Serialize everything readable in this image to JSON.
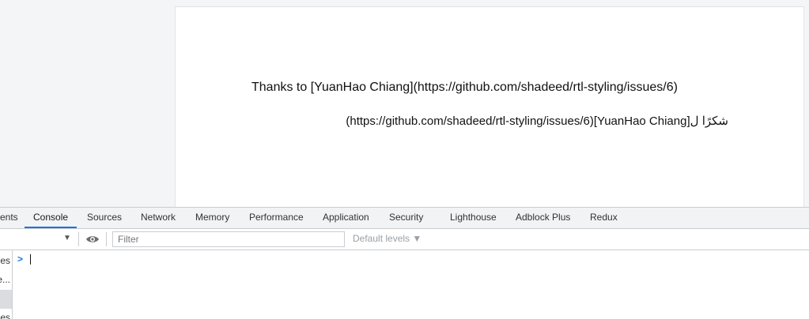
{
  "page": {
    "ltr_text": "Thanks to [YuanHao Chiang](https://github.com/shadeed/rtl-styling/issues/6)",
    "rtl_text": "شكرًا ل[YuanHao Chiang](https://github.com/shadeed/rtl-styling/issues/6)"
  },
  "devtools": {
    "tabs": [
      {
        "label": "ents"
      },
      {
        "label": "Console"
      },
      {
        "label": "Sources"
      },
      {
        "label": "Network"
      },
      {
        "label": "Memory"
      },
      {
        "label": "Performance"
      },
      {
        "label": "Application"
      },
      {
        "label": "Security"
      },
      {
        "label": "Lighthouse"
      },
      {
        "label": "Adblock Plus"
      },
      {
        "label": "Redux"
      }
    ],
    "active_tab": "Console",
    "toolbar": {
      "filter_placeholder": "Filter",
      "levels_label": "Default levels ▼"
    },
    "sidebar_items": [
      {
        "label": "es"
      },
      {
        "label": "e..."
      },
      {
        "label": "es"
      }
    ],
    "prompt_symbol": ">"
  },
  "colors": {
    "accent": "#1a73e8",
    "panel_bg": "#f1f3f4",
    "border": "#cacdd1"
  }
}
